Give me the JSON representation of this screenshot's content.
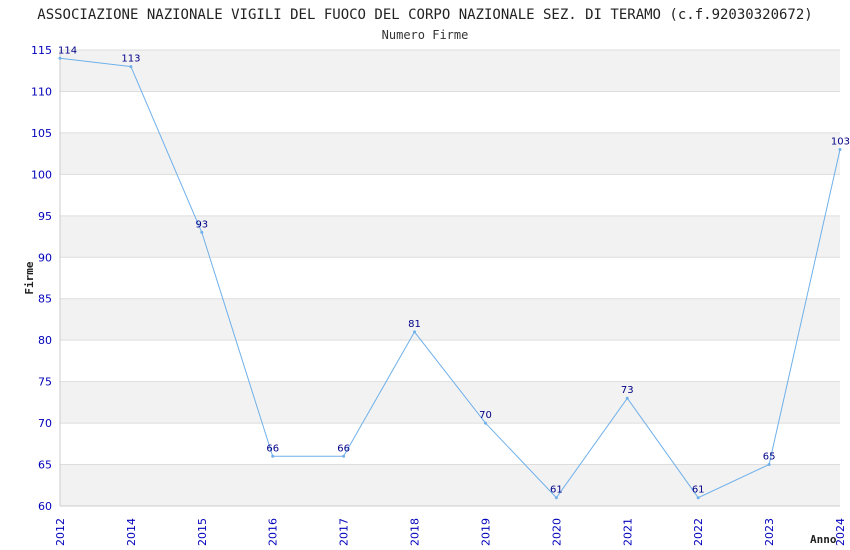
{
  "chart_data": {
    "type": "line",
    "title": "ASSOCIAZIONE NAZIONALE VIGILI DEL FUOCO DEL CORPO NAZIONALE SEZ. DI TERAMO (c.f.92030320672)",
    "subtitle": "Numero Firme",
    "xlabel": "Anno",
    "ylabel": "Firme",
    "categories": [
      "2012",
      "2014",
      "2015",
      "2016",
      "2017",
      "2018",
      "2019",
      "2020",
      "2021",
      "2022",
      "2023",
      "2024"
    ],
    "series": [
      {
        "values": [
          114,
          113,
          93,
          66,
          66,
          81,
          70,
          61,
          73,
          61,
          65,
          103
        ]
      }
    ],
    "ylim": [
      60,
      115
    ],
    "yticks": [
      "60",
      "65",
      "70",
      "75",
      "80",
      "85",
      "90",
      "95",
      "100",
      "105",
      "110",
      "115"
    ],
    "grid": true,
    "colors": {
      "line": "#6fb0ea",
      "band": "#f2f2f2",
      "grid": "#dddddd",
      "tick": "#0000bb",
      "label": "#000088"
    }
  }
}
